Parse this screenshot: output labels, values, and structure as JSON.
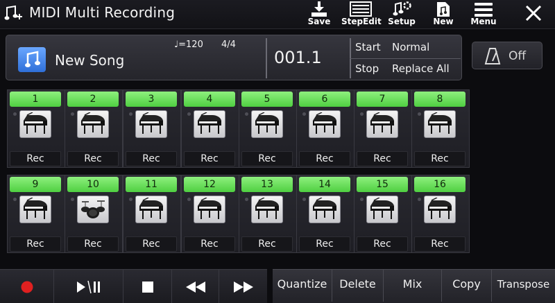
{
  "title": "MIDI Multi Recording",
  "toolbar": [
    {
      "label": "Save",
      "icon": "save-icon"
    },
    {
      "label": "StepEdit",
      "icon": "step-edit-icon"
    },
    {
      "label": "Setup",
      "icon": "setup-icon"
    },
    {
      "label": "New",
      "icon": "new-song-icon"
    },
    {
      "label": "Menu",
      "icon": "menu-icon"
    }
  ],
  "song": {
    "name": "New Song",
    "tempo": "♩=120",
    "meter": "4/4",
    "position": "001.1",
    "start_label": "Start",
    "start_value": "Normal",
    "stop_label": "Stop",
    "stop_value": "Replace All"
  },
  "metronome": {
    "state": "Off"
  },
  "tracks": [
    {
      "num": "1",
      "rec": "Rec",
      "instrument": "grand-piano"
    },
    {
      "num": "2",
      "rec": "Rec",
      "instrument": "grand-piano"
    },
    {
      "num": "3",
      "rec": "Rec",
      "instrument": "grand-piano"
    },
    {
      "num": "4",
      "rec": "Rec",
      "instrument": "grand-piano"
    },
    {
      "num": "5",
      "rec": "Rec",
      "instrument": "grand-piano"
    },
    {
      "num": "6",
      "rec": "Rec",
      "instrument": "grand-piano"
    },
    {
      "num": "7",
      "rec": "Rec",
      "instrument": "grand-piano"
    },
    {
      "num": "8",
      "rec": "Rec",
      "instrument": "grand-piano"
    },
    {
      "num": "9",
      "rec": "Rec",
      "instrument": "grand-piano"
    },
    {
      "num": "10",
      "rec": "Rec",
      "instrument": "drum-kit"
    },
    {
      "num": "11",
      "rec": "Rec",
      "instrument": "grand-piano"
    },
    {
      "num": "12",
      "rec": "Rec",
      "instrument": "grand-piano"
    },
    {
      "num": "13",
      "rec": "Rec",
      "instrument": "grand-piano"
    },
    {
      "num": "14",
      "rec": "Rec",
      "instrument": "grand-piano"
    },
    {
      "num": "15",
      "rec": "Rec",
      "instrument": "grand-piano"
    },
    {
      "num": "16",
      "rec": "Rec",
      "instrument": "grand-piano"
    }
  ],
  "transport": [
    {
      "icon": "record-icon"
    },
    {
      "icon": "play-pause-icon"
    },
    {
      "icon": "stop-icon"
    },
    {
      "icon": "rewind-icon"
    },
    {
      "icon": "fast-forward-icon"
    }
  ],
  "edit_buttons": [
    "Quantize",
    "Delete",
    "Mix",
    "Copy",
    "Transpose"
  ],
  "colors": {
    "track_number_green": "#6ee05c",
    "record_red": "#e02020",
    "note_icon_blue": "#3f7fe6"
  }
}
